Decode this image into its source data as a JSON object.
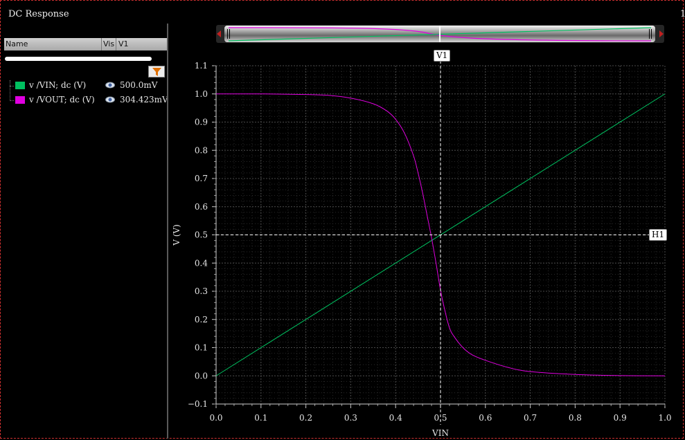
{
  "window": {
    "title": "DC Response",
    "corner_number": "1"
  },
  "list": {
    "headers": [
      "Name",
      "Vis",
      "V1"
    ],
    "signals": [
      {
        "name": "v /VIN; dc (V)",
        "color": "#00c060",
        "value": "500.0mV",
        "icon": "eye-icon"
      },
      {
        "name": "v /VOUT; dc (V)",
        "color": "#e000e0",
        "value": "304.423mV",
        "icon": "eye-icon"
      }
    ],
    "filter_icon": "funnel-icon"
  },
  "cursors": {
    "vertical": "V1",
    "horizontal": "H1"
  },
  "chart_data": {
    "type": "line",
    "xlabel": "VIN",
    "ylabel": "V (V)",
    "xlim": [
      0.0,
      1.0
    ],
    "ylim": [
      -0.1,
      1.1
    ],
    "x_ticks": [
      "0.0",
      "0.1",
      "0.2",
      "0.3",
      "0.4",
      "0.5",
      "0.6",
      "0.7",
      "0.8",
      "0.9",
      "1.0"
    ],
    "y_ticks": [
      "-0.1",
      "0.0",
      "0.1",
      "0.2",
      "0.3",
      "0.4",
      "0.5",
      "0.6",
      "0.7",
      "0.8",
      "0.9",
      "1.0",
      "1.1"
    ],
    "grid": true,
    "cursor_v1_x": 0.5,
    "cursor_h1_y": 0.5,
    "series": [
      {
        "name": "v /VIN; dc (V)",
        "color": "#00c060",
        "x": [
          0.0,
          1.0
        ],
        "y": [
          0.0,
          1.0
        ]
      },
      {
        "name": "v /VOUT; dc (V)",
        "color": "#e000e0",
        "x": [
          0.0,
          0.1,
          0.2,
          0.25,
          0.3,
          0.35,
          0.38,
          0.4,
          0.42,
          0.44,
          0.45,
          0.46,
          0.47,
          0.48,
          0.49,
          0.5,
          0.51,
          0.52,
          0.53,
          0.55,
          0.57,
          0.6,
          0.65,
          0.7,
          0.8,
          0.9,
          1.0
        ],
        "y": [
          1.0,
          1.0,
          0.998,
          0.995,
          0.985,
          0.965,
          0.94,
          0.91,
          0.86,
          0.78,
          0.72,
          0.65,
          0.57,
          0.49,
          0.4,
          0.304,
          0.23,
          0.17,
          0.14,
          0.1,
          0.075,
          0.055,
          0.03,
          0.015,
          0.005,
          0.001,
          0.0
        ]
      }
    ]
  }
}
